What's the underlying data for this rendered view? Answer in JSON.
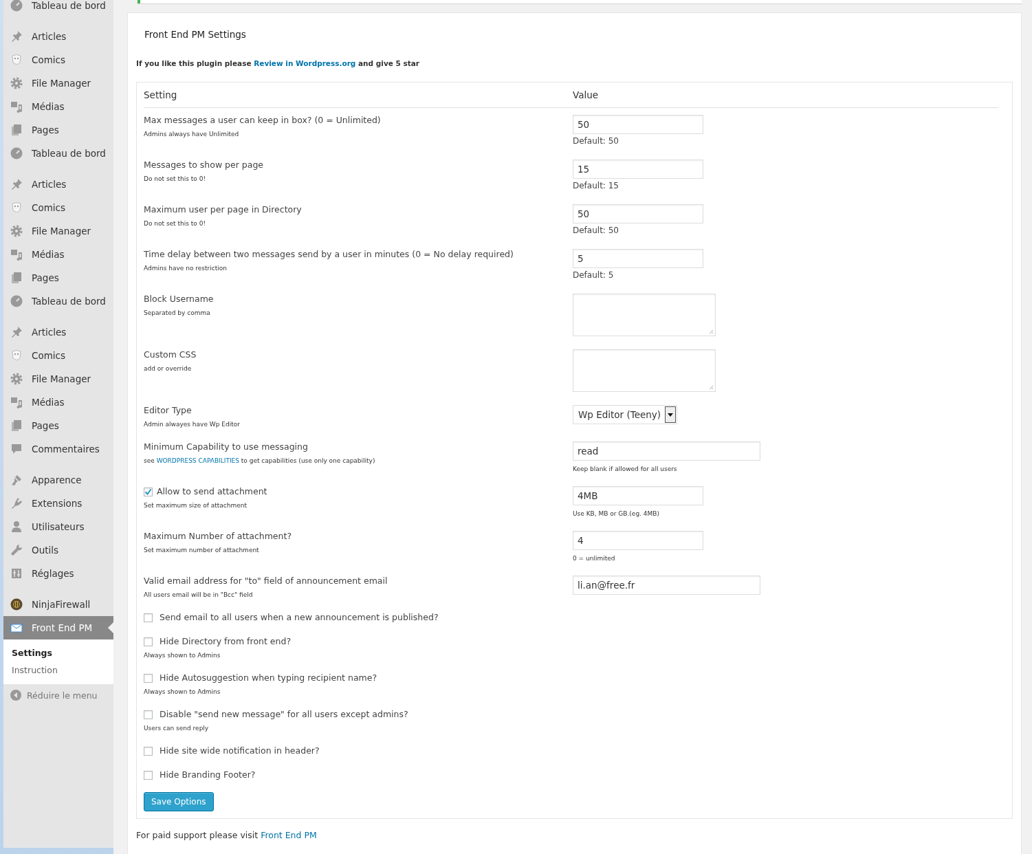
{
  "sidebar": {
    "groups": [
      {
        "items": [
          {
            "label": "Tableau de bord",
            "kind": "dashboard",
            "selected": false
          }
        ]
      },
      {
        "items": [
          {
            "label": "Articles",
            "kind": "posts",
            "selected": false
          },
          {
            "label": "Comics",
            "kind": "comics",
            "selected": false
          },
          {
            "label": "File Manager",
            "kind": "files",
            "selected": false
          },
          {
            "label": "Médias",
            "kind": "media",
            "selected": false
          },
          {
            "label": "Pages",
            "kind": "pages",
            "selected": false
          },
          {
            "label": "Tableau de bord",
            "kind": "dashboard",
            "selected": false
          }
        ]
      },
      {
        "items": [
          {
            "label": "Articles",
            "kind": "posts",
            "selected": false
          },
          {
            "label": "Comics",
            "kind": "comics",
            "selected": false
          },
          {
            "label": "File Manager",
            "kind": "files",
            "selected": false
          },
          {
            "label": "Médias",
            "kind": "media",
            "selected": false
          },
          {
            "label": "Pages",
            "kind": "pages",
            "selected": false
          },
          {
            "label": "Tableau de bord",
            "kind": "dashboard",
            "selected": false
          }
        ]
      },
      {
        "items": [
          {
            "label": "Articles",
            "kind": "posts",
            "selected": false
          },
          {
            "label": "Comics",
            "kind": "comics",
            "selected": false
          },
          {
            "label": "File Manager",
            "kind": "files",
            "selected": false
          },
          {
            "label": "Médias",
            "kind": "media",
            "selected": false
          },
          {
            "label": "Pages",
            "kind": "pages",
            "selected": false
          },
          {
            "label": "Commentaires",
            "kind": "comments",
            "selected": false
          }
        ]
      },
      {
        "items": [
          {
            "label": "Apparence",
            "kind": "appearance",
            "selected": false
          },
          {
            "label": "Extensions",
            "kind": "plugins",
            "selected": false
          },
          {
            "label": "Utilisateurs",
            "kind": "users",
            "selected": false
          },
          {
            "label": "Outils",
            "kind": "tools",
            "selected": false
          },
          {
            "label": "Réglages",
            "kind": "settings",
            "selected": false
          }
        ]
      },
      {
        "items": [
          {
            "label": "NinjaFirewall",
            "kind": "firewall",
            "selected": false
          },
          {
            "label": "Front End PM",
            "kind": "mail",
            "selected": true
          }
        ]
      }
    ],
    "submenu": [
      {
        "label": "Settings",
        "selected": true
      },
      {
        "label": "Instruction",
        "selected": false
      }
    ],
    "collapse": "Réduire le menu"
  },
  "page": {
    "title": "Front End PM Settings",
    "intro": {
      "before": "If you like this plugin please ",
      "link": "Review in Wordpress.org",
      "after": " and give 5 star"
    },
    "table": {
      "columns": [
        "Setting",
        "Value"
      ],
      "rows": [
        {
          "kind": "short-text",
          "label": "Max messages a user can keep in box? (0 = Unlimited)",
          "description": "Admins always have Unlimited",
          "value": "50",
          "note": "Default: 50"
        },
        {
          "kind": "short-text",
          "label": "Messages to show per page",
          "description": "Do not set this to 0!",
          "value": "15",
          "note": "Default: 15"
        },
        {
          "kind": "short-text",
          "label": "Maximum user per page in Directory",
          "description": "Do not set this to 0!",
          "value": "50",
          "note": "Default: 50"
        },
        {
          "kind": "short-text",
          "label": "Time delay between two messages send by a user in minutes (0 = No delay required)",
          "description": "Admins have no restriction",
          "value": "5",
          "note": "Default: 5"
        },
        {
          "kind": "textarea",
          "label": "Block Username",
          "description": "Separated by comma"
        },
        {
          "kind": "textarea",
          "label": "Custom CSS",
          "description": "add or override"
        },
        {
          "kind": "select",
          "label": "Editor Type",
          "description": "Admin alwayes have Wp Editor",
          "value": "Wp Editor (Teeny)"
        },
        {
          "kind": "long-text",
          "label": "Minimum Capability to use messaging",
          "description": "see ",
          "description_link": "WORDPRESS CAPABILITIES",
          "description_tail": " to get capabilities (use only one capability)",
          "value": "read",
          "small_note": "Keep blank if allowed for all users"
        },
        {
          "kind": "checkbox-text",
          "checked": true,
          "label": "Allow to send attachment",
          "description": "Set maximum size of attachment",
          "value": "4MB",
          "small_note": "Use KB, MB or GB.(eg. 4MB)"
        },
        {
          "kind": "short-text",
          "label": "Maximum Number of attachment?",
          "description": "Set maximum number of attachment",
          "value": "4",
          "small_note": "0 = unlimited"
        },
        {
          "kind": "long-text",
          "label": "Valid email address for \"to\" field of announcement email",
          "description": "All users email will be in \"Bcc\" field",
          "value": "li.an@free.fr"
        },
        {
          "kind": "checkbox",
          "checked": false,
          "label": "Send email to all users when a new announcement is published?"
        },
        {
          "kind": "checkbox",
          "checked": false,
          "label": "Hide Directory from front end?",
          "description": "Always shown to Admins"
        },
        {
          "kind": "checkbox",
          "checked": false,
          "label": "Hide Autosuggestion when typing recipient name?",
          "description": "Always shown to Admins"
        },
        {
          "kind": "checkbox",
          "checked": false,
          "label": "Disable \"send new message\" for all users except admins?",
          "description": "Users can send reply"
        },
        {
          "kind": "checkbox",
          "checked": false,
          "label": "Hide site wide notification in header?"
        },
        {
          "kind": "checkbox",
          "checked": false,
          "label": "Hide Branding Footer?"
        }
      ]
    },
    "save_button": "Save Options",
    "footer": {
      "text": "For paid support please visit ",
      "link": "Front End PM"
    }
  }
}
